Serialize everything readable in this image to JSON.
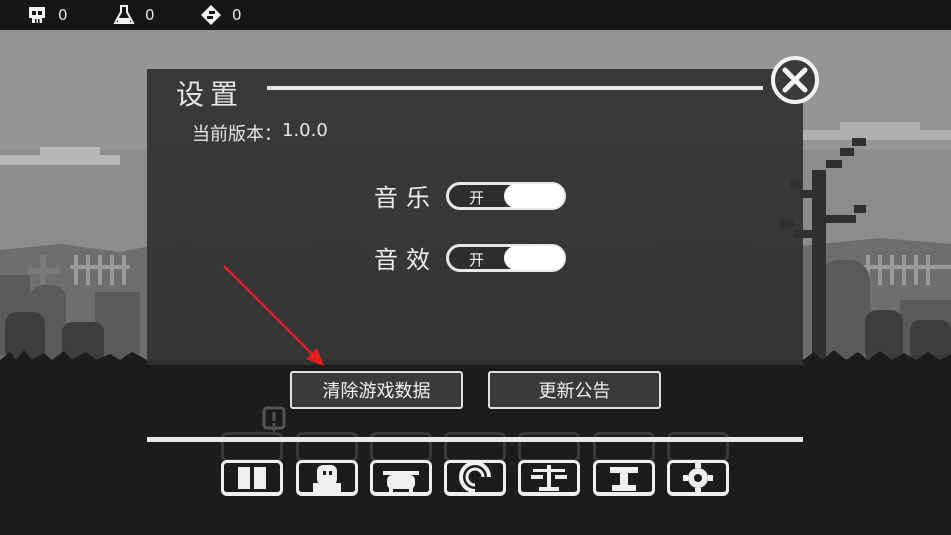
{
  "hud": {
    "kills": "0",
    "potions": "0",
    "gems": "0"
  },
  "dialog": {
    "title": "设置",
    "version_label": "当前版本：",
    "version_value": "1.0.0",
    "music_label": "音乐",
    "music_state": "开",
    "sfx_label": "音效",
    "sfx_state": "开",
    "clear_data_label": "清除游戏数据",
    "update_notice_label": "更新公告"
  },
  "bottom_menu": {
    "items": [
      "gift-icon",
      "character-icon",
      "cauldron-icon",
      "spiral-icon",
      "scale-icon",
      "anvil-icon",
      "gear-icon"
    ],
    "alert_badge": "!"
  },
  "colors": {
    "background": "#1c1c1c",
    "sky": "#8f8f8f",
    "dialog_bg": "#323232",
    "accent": "#e8e8e8",
    "arrow": "#e02020"
  }
}
